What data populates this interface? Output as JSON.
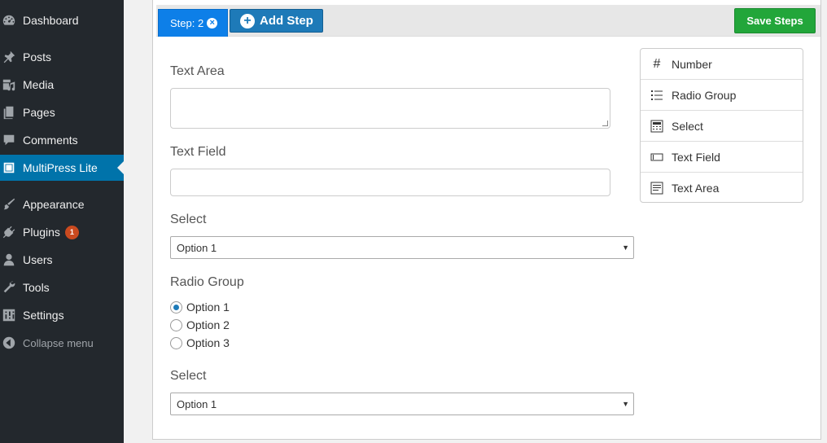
{
  "sidebar": {
    "items": [
      {
        "label": "Dashboard",
        "icon": "dashboard-icon"
      },
      {
        "label": "Posts",
        "icon": "pin-icon"
      },
      {
        "label": "Media",
        "icon": "media-icon"
      },
      {
        "label": "Pages",
        "icon": "pages-icon"
      },
      {
        "label": "Comments",
        "icon": "comment-icon"
      },
      {
        "label": "MultiPress Lite",
        "icon": "book-icon",
        "active": true
      },
      {
        "label": "Appearance",
        "icon": "brush-icon"
      },
      {
        "label": "Plugins",
        "icon": "plug-icon",
        "badge": "1"
      },
      {
        "label": "Users",
        "icon": "user-icon"
      },
      {
        "label": "Tools",
        "icon": "wrench-icon"
      },
      {
        "label": "Settings",
        "icon": "settings-icon"
      },
      {
        "label": "Collapse menu",
        "icon": "collapse-icon"
      }
    ]
  },
  "toolbar": {
    "step_tab_label": "Step: 2",
    "add_step_label": "Add Step",
    "save_label": "Save Steps"
  },
  "form": {
    "textarea_label": "Text Area",
    "textfield_label": "Text Field",
    "select1_label": "Select",
    "select1_value": "Option 1",
    "radio_label": "Radio Group",
    "radio_options": [
      "Option 1",
      "Option 2",
      "Option 3"
    ],
    "radio_selected": 0,
    "select2_label": "Select",
    "select2_value": "Option 1"
  },
  "fieldlist": {
    "items": [
      {
        "label": "Number",
        "icon": "hash-icon"
      },
      {
        "label": "Radio Group",
        "icon": "list-icon"
      },
      {
        "label": "Select",
        "icon": "select-icon"
      },
      {
        "label": "Text Field",
        "icon": "textfield-icon"
      },
      {
        "label": "Text Area",
        "icon": "textarea-icon"
      }
    ]
  },
  "colors": {
    "sidebar_bg": "#23282d",
    "active": "#0073aa",
    "step_tab": "#0d7fe8",
    "add_button": "#1e7ab8",
    "save_button": "#22a63a",
    "badge": "#ca4a1f"
  }
}
